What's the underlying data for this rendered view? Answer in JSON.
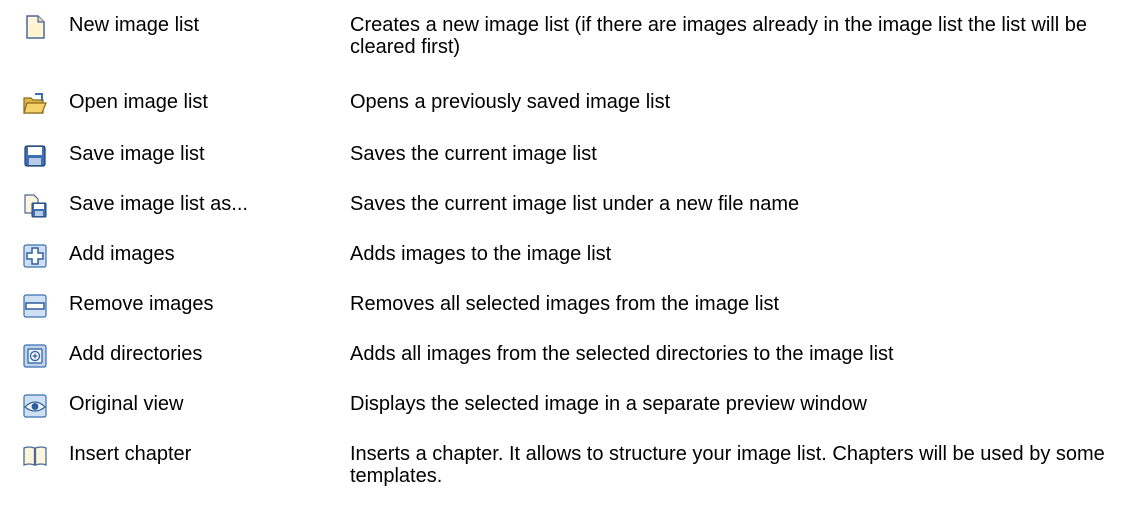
{
  "commands": [
    {
      "icon": "new-document-icon",
      "name": "New image list",
      "description": "Creates a new image list (if there are images already in the image list the list will be cleared first)"
    },
    {
      "icon": "open-folder-icon",
      "name": "Open image list",
      "description": "Opens a previously saved image list"
    },
    {
      "icon": "floppy-disk-icon",
      "name": "Save image list",
      "description": "Saves the current image list"
    },
    {
      "icon": "save-as-icon",
      "name": "Save image list as...",
      "description": "Saves the current image list under a new file name"
    },
    {
      "icon": "plus-icon",
      "name": "Add images",
      "description": "Adds images to the image list"
    },
    {
      "icon": "minus-icon",
      "name": "Remove images",
      "description": "Removes all selected images from the image list"
    },
    {
      "icon": "add-directory-icon",
      "name": "Add directories",
      "description": "Adds all images from the selected directories to the image list"
    },
    {
      "icon": "eye-icon",
      "name": "Original view",
      "description": "Displays the selected image in a separate preview window"
    },
    {
      "icon": "book-icon",
      "name": "Insert chapter",
      "description": "Inserts a chapter. It allows to structure your image list. Chapters will be used by some templates."
    }
  ]
}
